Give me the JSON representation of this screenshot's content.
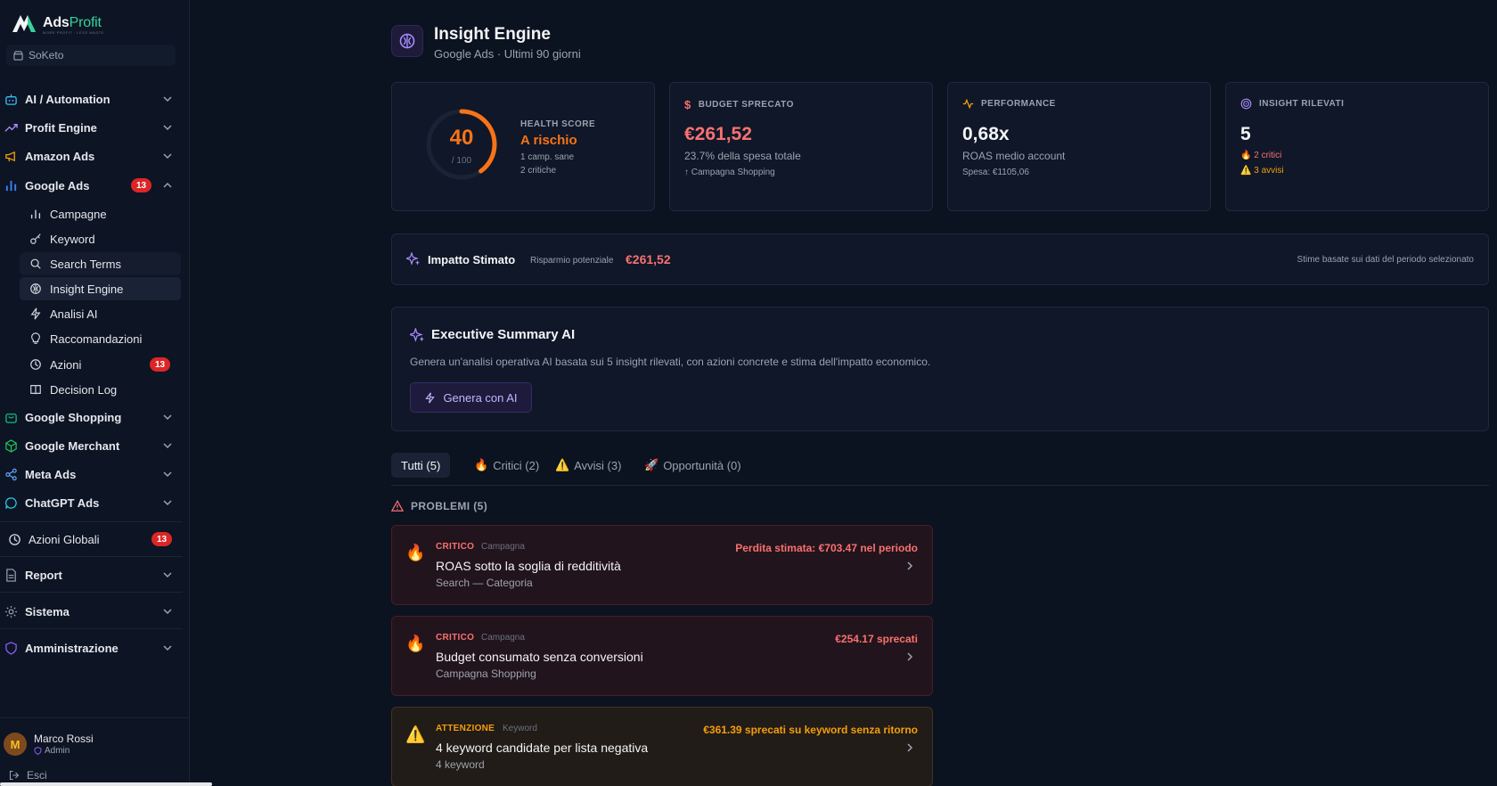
{
  "brand": {
    "name_part1": "Ads",
    "name_part2": "Profit",
    "tagline": "MORE PROFIT · LESS WASTE"
  },
  "account": {
    "name": "SoKeto"
  },
  "nav": {
    "ai_automation": "AI / Automation",
    "profit_engine": "Profit Engine",
    "amazon_ads": "Amazon Ads",
    "google_ads": "Google Ads",
    "google_ads_badge": "13",
    "google_ads_sub": {
      "campagne": "Campagne",
      "keyword": "Keyword",
      "search_terms": "Search Terms",
      "insight_engine": "Insight Engine",
      "analisi_ai": "Analisi AI",
      "raccomandazioni": "Raccomandazioni",
      "azioni": "Azioni",
      "azioni_badge": "13",
      "decision_log": "Decision Log"
    },
    "google_shopping": "Google Shopping",
    "google_merchant": "Google Merchant",
    "meta_ads": "Meta Ads",
    "chatgpt_ads": "ChatGPT Ads",
    "azioni_globali": "Azioni Globali",
    "azioni_globali_badge": "13",
    "report": "Report",
    "sistema": "Sistema",
    "amministrazione": "Amministrazione"
  },
  "user": {
    "initial": "M",
    "name": "Marco Rossi",
    "role": "Admin",
    "logout": "Esci"
  },
  "header": {
    "title": "Insight Engine",
    "subtitle": "Google Ads · Ultimi 90 giorni"
  },
  "health": {
    "score": "40",
    "score_value": 40,
    "max": "/ 100",
    "label": "HEALTH SCORE",
    "status": "A rischio",
    "line1": "1 camp. sane",
    "line2": "2 critiche"
  },
  "kpis": {
    "budget": {
      "label": "BUDGET SPRECATO",
      "value": "€261,52",
      "sub": "23.7% della spesa totale",
      "sub2": "↑ Campagna Shopping"
    },
    "performance": {
      "label": "PERFORMANCE",
      "value": "0,68x",
      "sub": "ROAS medio account",
      "sub2": "Spesa: €1105,06"
    },
    "insight": {
      "label": "INSIGHT RILEVATI",
      "value": "5",
      "critici": "2 critici",
      "avvisi": "3 avvisi"
    }
  },
  "impact": {
    "title": "Impatto Stimato",
    "label": "Risparmio potenziale",
    "value": "€261,52",
    "note": "Stime basate sui dati del periodo selezionato"
  },
  "executive": {
    "title": "Executive Summary AI",
    "desc": "Genera un'analisi operativa AI basata sui 5 insight rilevati, con azioni concrete e stima dell'impatto economico.",
    "button": "Genera con AI"
  },
  "tabs": {
    "all": "Tutti (5)",
    "critical": "Critici (2)",
    "warnings": "Avvisi (3)",
    "opportunities": "Opportunità (0)"
  },
  "problems": {
    "title": "PROBLEMI (5)",
    "items": [
      {
        "severity": "CRITICO",
        "category": "Campagna",
        "title": "ROAS sotto la soglia di redditività",
        "subtitle": "Search — Categoria",
        "loss": "Perdita stimata: €703.47 nel periodo"
      },
      {
        "severity": "CRITICO",
        "category": "Campagna",
        "title": "Budget consumato senza conversioni",
        "subtitle": "Campagna Shopping",
        "loss": "€254.17 sprecati"
      },
      {
        "severity": "ATTENZIONE",
        "category": "Keyword",
        "title": "4 keyword candidate per lista negativa",
        "subtitle": "4 keyword",
        "loss": "€361.39 sprecati su keyword senza ritorno"
      }
    ]
  },
  "colors": {
    "accent": "#8b5cf6",
    "danger": "#f87171",
    "warning": "#f59e0b",
    "orange": "#f97316",
    "background": "#0b1220"
  }
}
